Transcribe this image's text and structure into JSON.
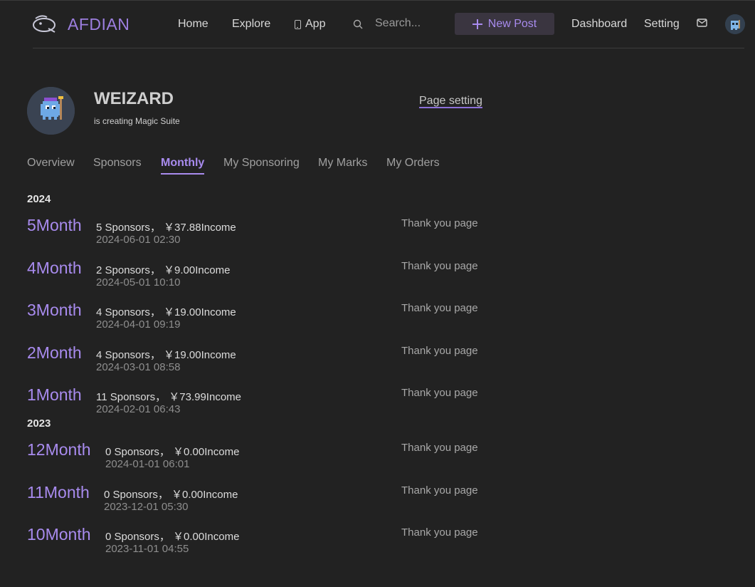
{
  "header": {
    "brand": "AFDIAN",
    "nav": {
      "home": "Home",
      "explore": "Explore",
      "app": "App",
      "dashboard": "Dashboard",
      "setting": "Setting"
    },
    "search": {
      "placeholder": "Search..."
    },
    "new_post": "New Post",
    "icons": {
      "logo": "afdian-logo-icon",
      "app": "phone-icon",
      "search": "search-icon",
      "new_post": "plus-icon",
      "mail": "mail-icon",
      "avatar": "user-avatar"
    }
  },
  "profile": {
    "name": "WEIZARD",
    "subtitle": "is creating Magic Suite",
    "page_setting": "Page setting"
  },
  "tabs": [
    {
      "label": "Overview"
    },
    {
      "label": "Sponsors"
    },
    {
      "label": "Monthly",
      "active": true
    },
    {
      "label": "My Sponsoring"
    },
    {
      "label": "My Marks"
    },
    {
      "label": "My Orders"
    }
  ],
  "years": [
    {
      "year": "2024",
      "months": [
        {
          "label": "5Month",
          "summary": "5 Sponsors， ￥37.88Income",
          "date": "2024-06-01 02:30",
          "link": "Thank you page"
        },
        {
          "label": "4Month",
          "summary": "2 Sponsors， ￥9.00Income",
          "date": "2024-05-01 10:10",
          "link": "Thank you page"
        },
        {
          "label": "3Month",
          "summary": "4 Sponsors， ￥19.00Income",
          "date": "2024-04-01 09:19",
          "link": "Thank you page"
        },
        {
          "label": "2Month",
          "summary": "4 Sponsors， ￥19.00Income",
          "date": "2024-03-01 08:58",
          "link": "Thank you page"
        },
        {
          "label": "1Month",
          "summary": "11 Sponsors， ￥73.99Income",
          "date": "2024-02-01 06:43",
          "link": "Thank you page"
        }
      ]
    },
    {
      "year": "2023",
      "months": [
        {
          "label": "12Month",
          "summary": "0 Sponsors， ￥0.00Income",
          "date": "2024-01-01 06:01",
          "link": "Thank you page"
        },
        {
          "label": "11Month",
          "summary": "0 Sponsors， ￥0.00Income",
          "date": "2023-12-01 05:30",
          "link": "Thank you page"
        },
        {
          "label": "10Month",
          "summary": "0 Sponsors， ￥0.00Income",
          "date": "2023-11-01 04:55",
          "link": "Thank you page"
        }
      ]
    }
  ],
  "colors": {
    "background": "#222222",
    "accent": "#a88bee",
    "text": "#d6d6d6",
    "muted": "#8e8e8e"
  }
}
